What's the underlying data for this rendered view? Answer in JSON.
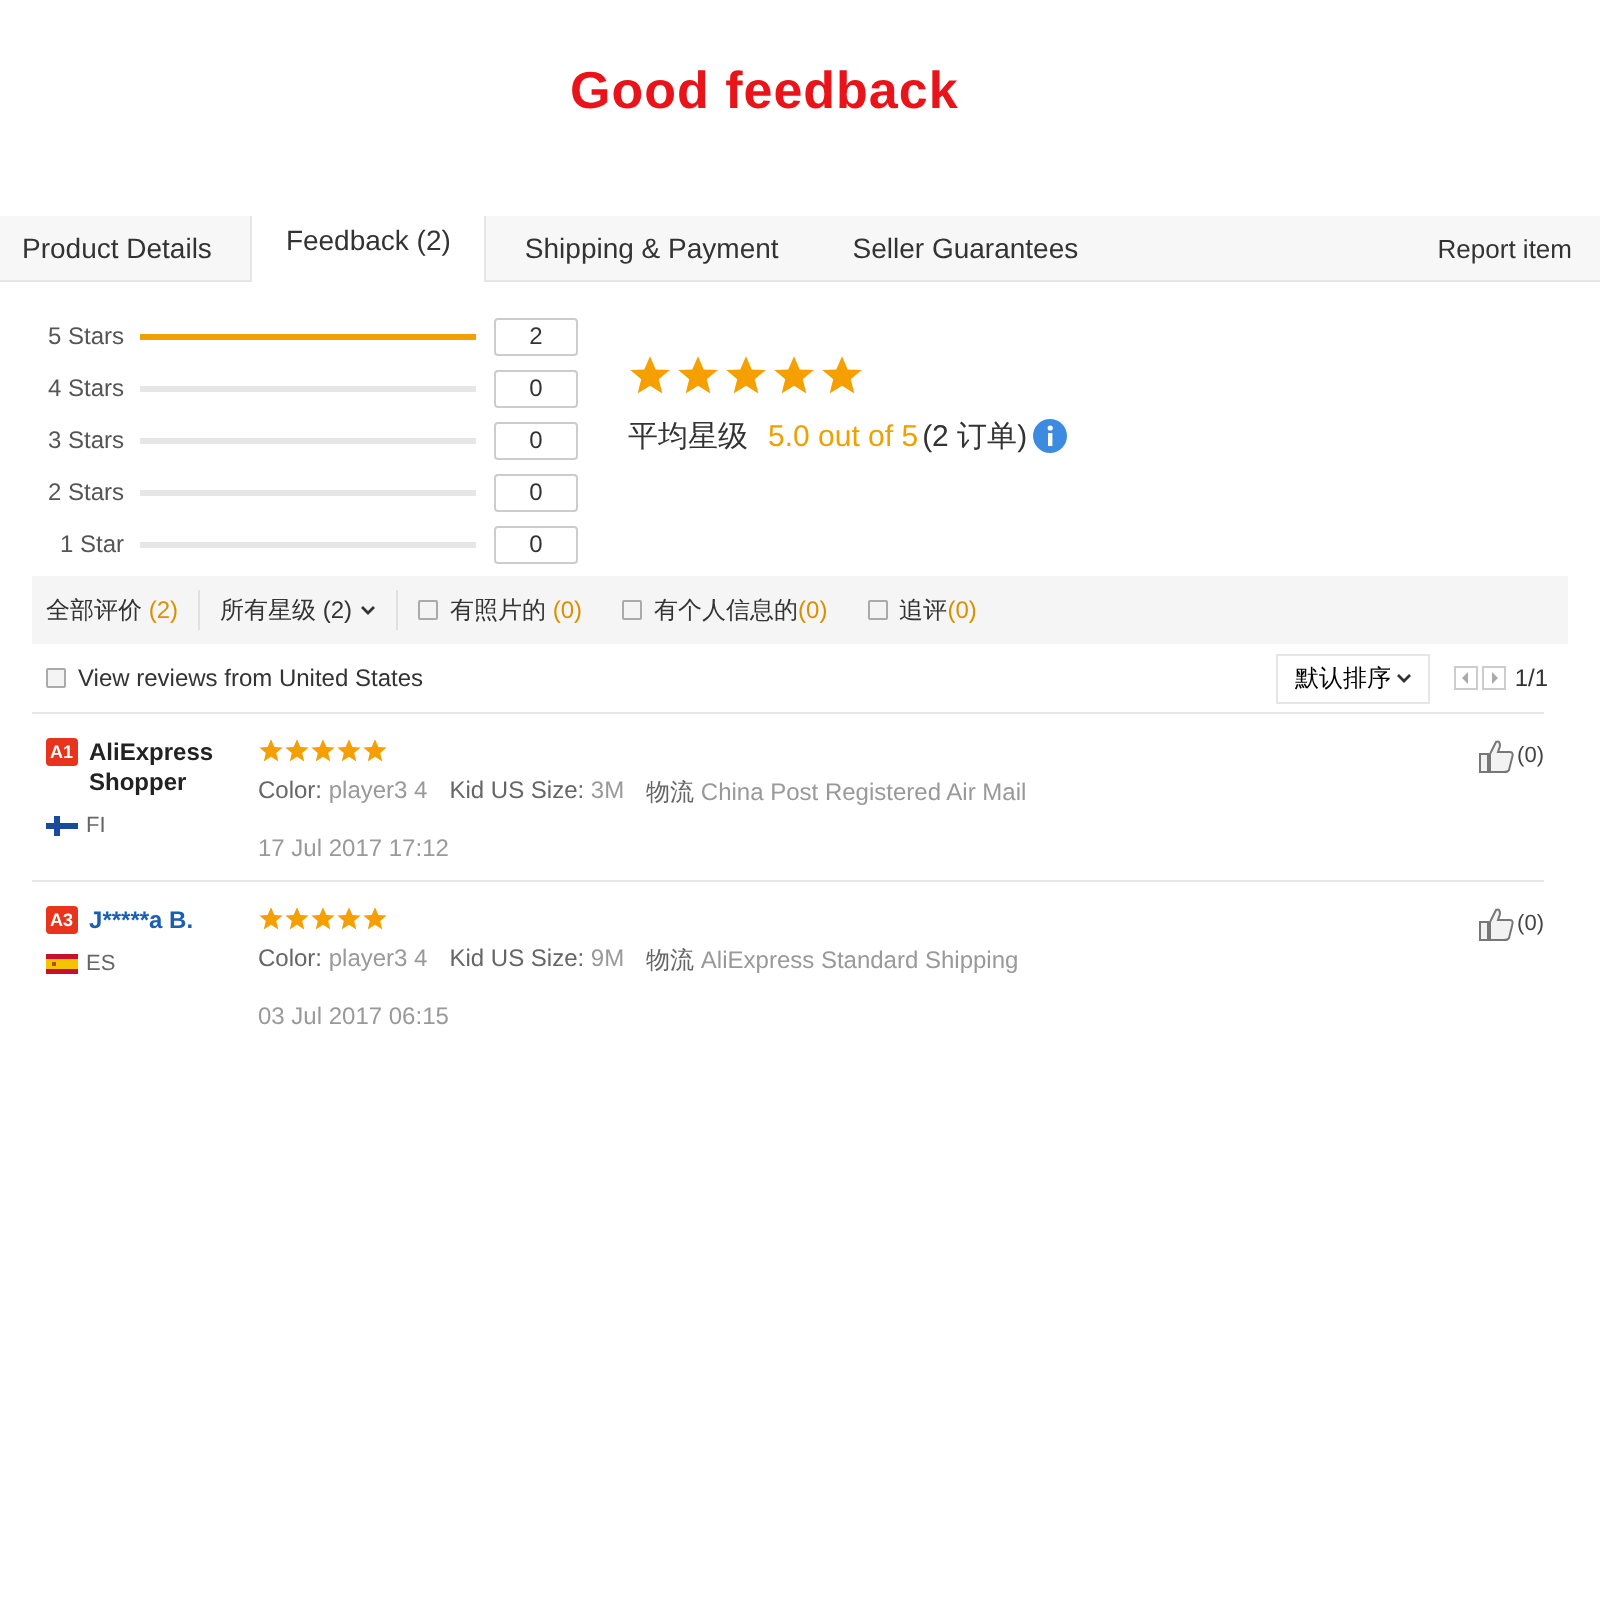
{
  "banner_title": "Good feedback",
  "tabs": [
    {
      "label": "Product Details",
      "selected": false
    },
    {
      "label": "Feedback (2)",
      "selected": true
    },
    {
      "label": "Shipping & Payment",
      "selected": false
    },
    {
      "label": "Seller Guarantees",
      "selected": false
    }
  ],
  "report_link": "Report item",
  "rating_bars": [
    {
      "label": "5 Stars",
      "level": 1,
      "count": "2"
    },
    {
      "label": "4 Stars",
      "level": 0,
      "count": "0"
    },
    {
      "label": "3 Stars",
      "level": 0,
      "count": "0"
    },
    {
      "label": "2 Stars",
      "level": 0,
      "count": "0"
    },
    {
      "label": "1 Star",
      "level": 0,
      "count": "0"
    }
  ],
  "summary": {
    "stars": 5,
    "label": "平均星级",
    "score": "5.0 out of 5",
    "orders": "(2 订单)"
  },
  "filters": [
    {
      "kind": "text",
      "label": "全部评价",
      "count": "(2)"
    },
    {
      "kind": "dropdown",
      "label": "所有星级 (2)"
    },
    {
      "kind": "checkbox",
      "label": "有照片的",
      "count": "(0)",
      "checked": false
    },
    {
      "kind": "checkbox",
      "label": "有个人信息的",
      "count": "(0)",
      "checked": false
    },
    {
      "kind": "checkbox",
      "label": "追评",
      "count": "(0)",
      "checked": false
    }
  ],
  "country_filter": {
    "label": "View reviews from United States",
    "checked": false
  },
  "sort": {
    "label": "默认排序"
  },
  "pager": "1/1",
  "reviews": [
    {
      "badge": "A1",
      "name": "AliExpress Shopper",
      "linked": false,
      "flag": {
        "kind": "nordic_cross"
      },
      "country": "FI",
      "stars": 5,
      "details": [
        {
          "label": "Color:",
          "value": "player3 4"
        },
        {
          "label": "Kid US Size:",
          "value": "3M"
        },
        {
          "label": "物流",
          "value": "China Post Registered Air Mail"
        }
      ],
      "date": "17 Jul 2017 17:12",
      "likes": "(0)"
    },
    {
      "badge": "A3",
      "name": "J*****a B.",
      "linked": true,
      "flag": {
        "kind": "horizontal_bands"
      },
      "country": "ES",
      "stars": 5,
      "details": [
        {
          "label": "Color:",
          "value": "player3 4"
        },
        {
          "label": "Kid US Size:",
          "value": "9M"
        },
        {
          "label": "物流",
          "value": "AliExpress Standard Shipping"
        }
      ],
      "date": "03 Jul 2017 06:15",
      "likes": "(0)"
    }
  ]
}
